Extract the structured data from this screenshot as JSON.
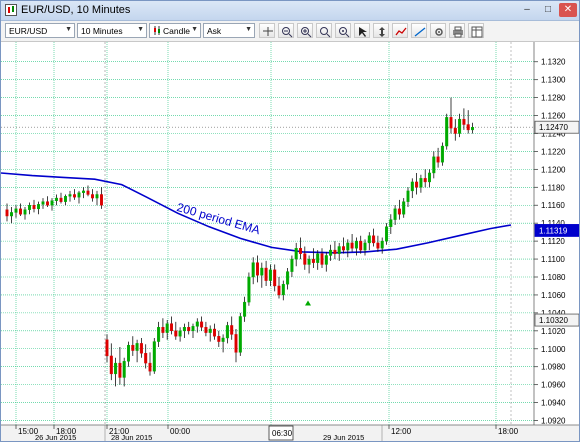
{
  "window": {
    "title": "EUR/USD, 10 Minutes",
    "controls": {
      "minimize": "–",
      "maximize": "□",
      "close": "✕"
    }
  },
  "toolbar": {
    "instrument": "EUR/USD",
    "period": "10 Minutes",
    "chart_type": "Candle",
    "side": "Ask",
    "icons": [
      "period-separator-icon",
      "zoom-out-icon",
      "zoom-in-icon",
      "zoom-in-alt-icon",
      "zoom-reset-icon",
      "select-icon",
      "pan-icon",
      "indicators-icon",
      "drawing-icon",
      "settings-icon",
      "print-icon",
      "table-icon"
    ]
  },
  "chart_data": {
    "type": "candlestick",
    "instrument": "EUR/USD",
    "timeframe": "10 Minutes",
    "colors": {
      "bull": "#00aa00",
      "bear": "#dd0000",
      "ema": "#0000cc",
      "grid": "#22c37f",
      "price_line": "#666666"
    },
    "ylim": [
      1.0915,
      1.1342
    ],
    "y_ticks": [
      "1.0920",
      "1.0940",
      "1.0960",
      "1.0980",
      "1.1000",
      "1.1020",
      "1.1040",
      "1.1060",
      "1.1080",
      "1.1100",
      "1.1120",
      "1.1140",
      "1.1160",
      "1.1180",
      "1.1200",
      "1.1220",
      "1.1240",
      "1.1260",
      "1.1280",
      "1.1300",
      "1.1320"
    ],
    "x_tick_labels": [
      "15:00",
      "18:00",
      "21:00",
      "00:00",
      "12:00",
      "18:00"
    ],
    "date_labels": [
      "26 Jun 2015",
      "28 Jun 2015",
      "29 Jun 2015"
    ],
    "crosshair_time_label": "06:30",
    "price_markers": [
      {
        "label": "1.12470",
        "value": 1.1247,
        "style": "plain"
      },
      {
        "label": "1.11319",
        "value": 1.11319,
        "style": "ema"
      },
      {
        "label": "1.10320",
        "value": 1.1032,
        "style": "plain"
      }
    ],
    "annotation": "200 period EMA",
    "ema": [
      {
        "x": 0,
        "y": 1.1196
      },
      {
        "x": 15,
        "y": 1.1193
      },
      {
        "x": 30,
        "y": 1.1191
      },
      {
        "x": 45,
        "y": 1.1189
      },
      {
        "x": 58,
        "y": 1.1183
      },
      {
        "x": 70,
        "y": 1.1169
      },
      {
        "x": 85,
        "y": 1.1151
      },
      {
        "x": 100,
        "y": 1.1136
      },
      {
        "x": 115,
        "y": 1.1123
      },
      {
        "x": 130,
        "y": 1.1113
      },
      {
        "x": 145,
        "y": 1.1108
      },
      {
        "x": 160,
        "y": 1.1107
      },
      {
        "x": 175,
        "y": 1.1108
      },
      {
        "x": 190,
        "y": 1.1111
      },
      {
        "x": 205,
        "y": 1.1118
      },
      {
        "x": 220,
        "y": 1.1126
      },
      {
        "x": 235,
        "y": 1.1134
      },
      {
        "x": 245,
        "y": 1.1138
      }
    ],
    "candles": [
      {
        "i": 0,
        "o": 1.1155,
        "h": 1.1162,
        "l": 1.1142,
        "c": 1.1148
      },
      {
        "i": 1,
        "o": 1.1148,
        "h": 1.1158,
        "l": 1.114,
        "c": 1.1152
      },
      {
        "i": 2,
        "o": 1.1152,
        "h": 1.116,
        "l": 1.1146,
        "c": 1.1156
      },
      {
        "i": 3,
        "o": 1.1156,
        "h": 1.1162,
        "l": 1.1148,
        "c": 1.115
      },
      {
        "i": 4,
        "o": 1.115,
        "h": 1.1158,
        "l": 1.1144,
        "c": 1.1155
      },
      {
        "i": 5,
        "o": 1.1155,
        "h": 1.1163,
        "l": 1.115,
        "c": 1.116
      },
      {
        "i": 6,
        "o": 1.116,
        "h": 1.1166,
        "l": 1.1152,
        "c": 1.1156
      },
      {
        "i": 7,
        "o": 1.1156,
        "h": 1.1164,
        "l": 1.115,
        "c": 1.1161
      },
      {
        "i": 8,
        "o": 1.1161,
        "h": 1.1168,
        "l": 1.1156,
        "c": 1.1164
      },
      {
        "i": 9,
        "o": 1.1164,
        "h": 1.117,
        "l": 1.1158,
        "c": 1.116
      },
      {
        "i": 10,
        "o": 1.116,
        "h": 1.1168,
        "l": 1.1154,
        "c": 1.1165
      },
      {
        "i": 11,
        "o": 1.1165,
        "h": 1.1172,
        "l": 1.116,
        "c": 1.1168
      },
      {
        "i": 12,
        "o": 1.1168,
        "h": 1.1174,
        "l": 1.1162,
        "c": 1.1164
      },
      {
        "i": 13,
        "o": 1.1164,
        "h": 1.1172,
        "l": 1.116,
        "c": 1.117
      },
      {
        "i": 14,
        "o": 1.117,
        "h": 1.1176,
        "l": 1.1164,
        "c": 1.1172
      },
      {
        "i": 15,
        "o": 1.1172,
        "h": 1.1178,
        "l": 1.1166,
        "c": 1.1169
      },
      {
        "i": 16,
        "o": 1.1169,
        "h": 1.1176,
        "l": 1.1162,
        "c": 1.1174
      },
      {
        "i": 17,
        "o": 1.1174,
        "h": 1.118,
        "l": 1.1168,
        "c": 1.1176
      },
      {
        "i": 18,
        "o": 1.1176,
        "h": 1.1182,
        "l": 1.117,
        "c": 1.1172
      },
      {
        "i": 19,
        "o": 1.1172,
        "h": 1.1178,
        "l": 1.1164,
        "c": 1.1168
      },
      {
        "i": 20,
        "o": 1.1168,
        "h": 1.1176,
        "l": 1.116,
        "c": 1.1172
      },
      {
        "i": 21,
        "o": 1.1172,
        "h": 1.118,
        "l": 1.1156,
        "c": 1.116
      },
      {
        "i": 22,
        "o": 1.101,
        "h": 1.1016,
        "l": 1.0985,
        "c": 1.0992
      },
      {
        "i": 23,
        "o": 1.0992,
        "h": 1.1006,
        "l": 1.0965,
        "c": 1.0972
      },
      {
        "i": 24,
        "o": 1.0972,
        "h": 1.099,
        "l": 1.0958,
        "c": 1.0984
      },
      {
        "i": 25,
        "o": 1.0984,
        "h": 1.1002,
        "l": 1.096,
        "c": 1.0968
      },
      {
        "i": 26,
        "o": 1.0968,
        "h": 1.099,
        "l": 1.0958,
        "c": 1.0986
      },
      {
        "i": 27,
        "o": 1.0986,
        "h": 1.1008,
        "l": 1.098,
        "c": 1.1004
      },
      {
        "i": 28,
        "o": 1.1004,
        "h": 1.1014,
        "l": 1.0992,
        "c": 1.0998
      },
      {
        "i": 29,
        "o": 1.0998,
        "h": 1.101,
        "l": 1.0985,
        "c": 1.1006
      },
      {
        "i": 30,
        "o": 1.1006,
        "h": 1.1012,
        "l": 1.099,
        "c": 1.0995
      },
      {
        "i": 31,
        "o": 1.0995,
        "h": 1.1005,
        "l": 1.0978,
        "c": 1.0984
      },
      {
        "i": 32,
        "o": 1.0984,
        "h": 1.0996,
        "l": 1.097,
        "c": 1.0975
      },
      {
        "i": 33,
        "o": 1.0975,
        "h": 1.1012,
        "l": 1.0972,
        "c": 1.1008
      },
      {
        "i": 34,
        "o": 1.1008,
        "h": 1.103,
        "l": 1.1002,
        "c": 1.1024
      },
      {
        "i": 35,
        "o": 1.1024,
        "h": 1.1034,
        "l": 1.1012,
        "c": 1.1018
      },
      {
        "i": 36,
        "o": 1.1018,
        "h": 1.1032,
        "l": 1.101,
        "c": 1.1028
      },
      {
        "i": 37,
        "o": 1.1028,
        "h": 1.1036,
        "l": 1.1016,
        "c": 1.102
      },
      {
        "i": 38,
        "o": 1.102,
        "h": 1.103,
        "l": 1.101,
        "c": 1.1014
      },
      {
        "i": 39,
        "o": 1.1014,
        "h": 1.1024,
        "l": 1.1008,
        "c": 1.102
      },
      {
        "i": 40,
        "o": 1.102,
        "h": 1.1028,
        "l": 1.1012,
        "c": 1.1024
      },
      {
        "i": 41,
        "o": 1.1024,
        "h": 1.103,
        "l": 1.1016,
        "c": 1.102
      },
      {
        "i": 42,
        "o": 1.102,
        "h": 1.1028,
        "l": 1.1012,
        "c": 1.1025
      },
      {
        "i": 43,
        "o": 1.1025,
        "h": 1.1034,
        "l": 1.1018,
        "c": 1.103
      },
      {
        "i": 44,
        "o": 1.103,
        "h": 1.1036,
        "l": 1.102,
        "c": 1.1024
      },
      {
        "i": 45,
        "o": 1.1024,
        "h": 1.103,
        "l": 1.1014,
        "c": 1.1018
      },
      {
        "i": 46,
        "o": 1.1018,
        "h": 1.1026,
        "l": 1.1008,
        "c": 1.1022
      },
      {
        "i": 47,
        "o": 1.1022,
        "h": 1.1028,
        "l": 1.101,
        "c": 1.1014
      },
      {
        "i": 48,
        "o": 1.1014,
        "h": 1.102,
        "l": 1.1002,
        "c": 1.1008
      },
      {
        "i": 49,
        "o": 1.1008,
        "h": 1.1016,
        "l": 1.0996,
        "c": 1.1012
      },
      {
        "i": 50,
        "o": 1.1012,
        "h": 1.103,
        "l": 1.1006,
        "c": 1.1026
      },
      {
        "i": 51,
        "o": 1.1026,
        "h": 1.1036,
        "l": 1.101,
        "c": 1.1016
      },
      {
        "i": 52,
        "o": 1.1016,
        "h": 1.1022,
        "l": 1.0985,
        "c": 1.0996
      },
      {
        "i": 53,
        "o": 1.0996,
        "h": 1.104,
        "l": 1.0992,
        "c": 1.1036
      },
      {
        "i": 54,
        "o": 1.1036,
        "h": 1.1058,
        "l": 1.103,
        "c": 1.1052
      },
      {
        "i": 55,
        "o": 1.1052,
        "h": 1.1085,
        "l": 1.1048,
        "c": 1.108
      },
      {
        "i": 56,
        "o": 1.108,
        "h": 1.1102,
        "l": 1.1072,
        "c": 1.1096
      },
      {
        "i": 57,
        "o": 1.1096,
        "h": 1.1104,
        "l": 1.1074,
        "c": 1.1082
      },
      {
        "i": 58,
        "o": 1.1082,
        "h": 1.1096,
        "l": 1.1068,
        "c": 1.109
      },
      {
        "i": 59,
        "o": 1.109,
        "h": 1.1098,
        "l": 1.107,
        "c": 1.1076
      },
      {
        "i": 60,
        "o": 1.1076,
        "h": 1.1094,
        "l": 1.107,
        "c": 1.1088
      },
      {
        "i": 61,
        "o": 1.1088,
        "h": 1.1094,
        "l": 1.1064,
        "c": 1.107
      },
      {
        "i": 62,
        "o": 1.107,
        "h": 1.108,
        "l": 1.1056,
        "c": 1.106
      },
      {
        "i": 63,
        "o": 1.106,
        "h": 1.1076,
        "l": 1.1054,
        "c": 1.1072
      },
      {
        "i": 64,
        "o": 1.1072,
        "h": 1.109,
        "l": 1.1066,
        "c": 1.1086
      },
      {
        "i": 65,
        "o": 1.1086,
        "h": 1.1104,
        "l": 1.108,
        "c": 1.11
      },
      {
        "i": 66,
        "o": 1.11,
        "h": 1.1118,
        "l": 1.1092,
        "c": 1.1112
      },
      {
        "i": 67,
        "o": 1.1112,
        "h": 1.1124,
        "l": 1.11,
        "c": 1.1106
      },
      {
        "i": 68,
        "o": 1.1106,
        "h": 1.1114,
        "l": 1.1088,
        "c": 1.1094
      },
      {
        "i": 69,
        "o": 1.1094,
        "h": 1.1104,
        "l": 1.1084,
        "c": 1.11
      },
      {
        "i": 70,
        "o": 1.11,
        "h": 1.1112,
        "l": 1.109,
        "c": 1.1096
      },
      {
        "i": 71,
        "o": 1.1096,
        "h": 1.111,
        "l": 1.1088,
        "c": 1.1106
      },
      {
        "i": 72,
        "o": 1.1106,
        "h": 1.1112,
        "l": 1.109,
        "c": 1.1094
      },
      {
        "i": 73,
        "o": 1.1094,
        "h": 1.1108,
        "l": 1.1086,
        "c": 1.1104
      },
      {
        "i": 74,
        "o": 1.1104,
        "h": 1.1116,
        "l": 1.1098,
        "c": 1.111
      },
      {
        "i": 75,
        "o": 1.111,
        "h": 1.112,
        "l": 1.11,
        "c": 1.1106
      },
      {
        "i": 76,
        "o": 1.1106,
        "h": 1.1118,
        "l": 1.1098,
        "c": 1.1114
      },
      {
        "i": 77,
        "o": 1.1114,
        "h": 1.1124,
        "l": 1.1106,
        "c": 1.111
      },
      {
        "i": 78,
        "o": 1.111,
        "h": 1.1122,
        "l": 1.1102,
        "c": 1.1118
      },
      {
        "i": 79,
        "o": 1.1118,
        "h": 1.1128,
        "l": 1.1108,
        "c": 1.1112
      },
      {
        "i": 80,
        "o": 1.1112,
        "h": 1.1124,
        "l": 1.1104,
        "c": 1.112
      },
      {
        "i": 81,
        "o": 1.112,
        "h": 1.1126,
        "l": 1.1106,
        "c": 1.111
      },
      {
        "i": 82,
        "o": 1.111,
        "h": 1.1122,
        "l": 1.1104,
        "c": 1.1118
      },
      {
        "i": 83,
        "o": 1.1118,
        "h": 1.113,
        "l": 1.111,
        "c": 1.1126
      },
      {
        "i": 84,
        "o": 1.1126,
        "h": 1.1134,
        "l": 1.1114,
        "c": 1.1118
      },
      {
        "i": 85,
        "o": 1.1118,
        "h": 1.1126,
        "l": 1.1108,
        "c": 1.1112
      },
      {
        "i": 86,
        "o": 1.1112,
        "h": 1.1124,
        "l": 1.1106,
        "c": 1.112
      },
      {
        "i": 87,
        "o": 1.112,
        "h": 1.114,
        "l": 1.1116,
        "c": 1.1136
      },
      {
        "i": 88,
        "o": 1.1136,
        "h": 1.115,
        "l": 1.1128,
        "c": 1.1144
      },
      {
        "i": 89,
        "o": 1.1144,
        "h": 1.116,
        "l": 1.1138,
        "c": 1.1156
      },
      {
        "i": 90,
        "o": 1.1156,
        "h": 1.1166,
        "l": 1.1144,
        "c": 1.115
      },
      {
        "i": 91,
        "o": 1.115,
        "h": 1.1168,
        "l": 1.1146,
        "c": 1.1164
      },
      {
        "i": 92,
        "o": 1.1164,
        "h": 1.118,
        "l": 1.1158,
        "c": 1.1176
      },
      {
        "i": 93,
        "o": 1.1176,
        "h": 1.119,
        "l": 1.1168,
        "c": 1.1186
      },
      {
        "i": 94,
        "o": 1.1186,
        "h": 1.1196,
        "l": 1.1172,
        "c": 1.118
      },
      {
        "i": 95,
        "o": 1.118,
        "h": 1.1194,
        "l": 1.1174,
        "c": 1.119
      },
      {
        "i": 96,
        "o": 1.119,
        "h": 1.12,
        "l": 1.118,
        "c": 1.1186
      },
      {
        "i": 97,
        "o": 1.1186,
        "h": 1.12,
        "l": 1.118,
        "c": 1.1196
      },
      {
        "i": 98,
        "o": 1.1196,
        "h": 1.122,
        "l": 1.119,
        "c": 1.1214
      },
      {
        "i": 99,
        "o": 1.1214,
        "h": 1.1224,
        "l": 1.1202,
        "c": 1.1208
      },
      {
        "i": 100,
        "o": 1.1208,
        "h": 1.123,
        "l": 1.1204,
        "c": 1.1226
      },
      {
        "i": 101,
        "o": 1.1226,
        "h": 1.1262,
        "l": 1.1222,
        "c": 1.1258
      },
      {
        "i": 102,
        "o": 1.1258,
        "h": 1.128,
        "l": 1.124,
        "c": 1.1246
      },
      {
        "i": 103,
        "o": 1.1246,
        "h": 1.1256,
        "l": 1.1232,
        "c": 1.124
      },
      {
        "i": 104,
        "o": 1.124,
        "h": 1.1262,
        "l": 1.1236,
        "c": 1.1256
      },
      {
        "i": 105,
        "o": 1.1256,
        "h": 1.1268,
        "l": 1.1244,
        "c": 1.125
      },
      {
        "i": 106,
        "o": 1.125,
        "h": 1.1266,
        "l": 1.124,
        "c": 1.1244
      },
      {
        "i": 107,
        "o": 1.1244,
        "h": 1.1252,
        "l": 1.124,
        "c": 1.1247
      }
    ]
  }
}
